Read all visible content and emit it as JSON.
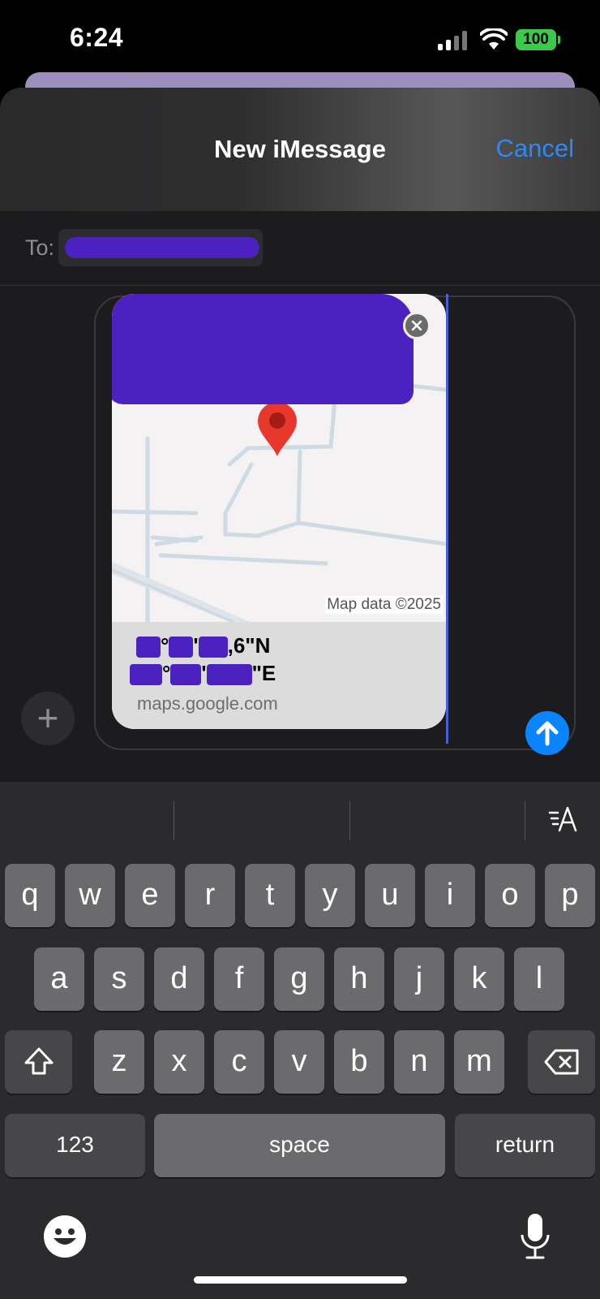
{
  "status_bar": {
    "time": "6:24",
    "battery": "100",
    "icons": [
      "signal-icon",
      "wifi-icon",
      "battery-icon"
    ]
  },
  "sheet": {
    "title": "New iMessage",
    "cancel_label": "Cancel"
  },
  "recipient": {
    "label": "To:"
  },
  "compose": {
    "add_icon": "plus-icon",
    "send_icon": "arrow-up-icon",
    "link_preview": {
      "map_attribution": "Map data ©2025",
      "lat_suffix": ",6\"N",
      "lon_suffix": "\"E",
      "deg": "°",
      "min": "'",
      "domain": "maps.google.com"
    }
  },
  "keyboard": {
    "format_icon": "text-format-icon",
    "row1": [
      "q",
      "w",
      "e",
      "r",
      "t",
      "y",
      "u",
      "i",
      "o",
      "p"
    ],
    "row2": [
      "a",
      "s",
      "d",
      "f",
      "g",
      "h",
      "j",
      "k",
      "l"
    ],
    "row3": [
      "z",
      "x",
      "c",
      "v",
      "b",
      "n",
      "m"
    ],
    "numbers_label": "123",
    "space_label": "space",
    "return_label": "return"
  },
  "colors": {
    "accent": "#0a84ff",
    "cancel": "#2b8af7",
    "redaction": "#4b22bf",
    "pin": "#e8382d"
  }
}
